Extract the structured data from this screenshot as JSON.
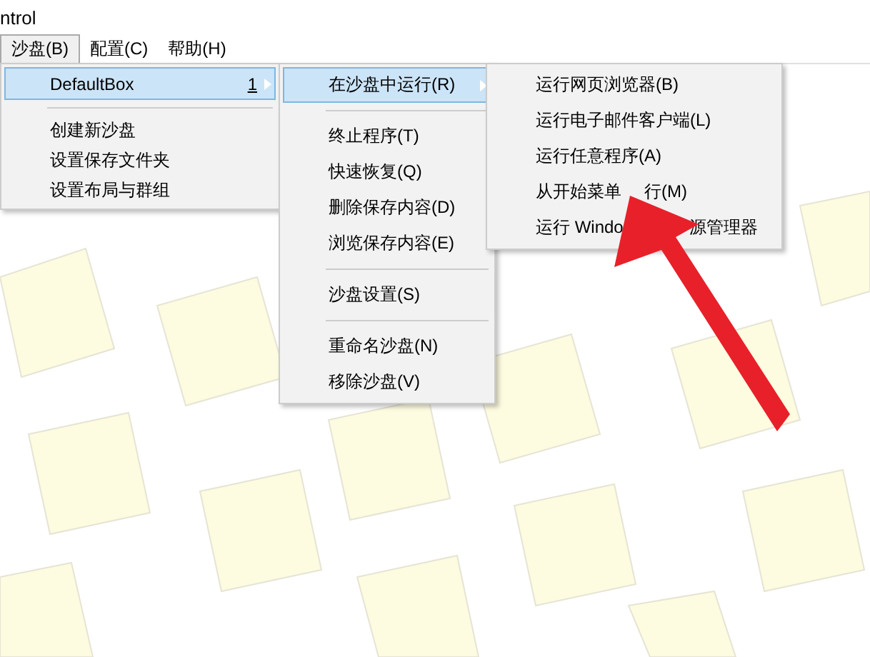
{
  "window": {
    "title": "ntrol"
  },
  "menubar": [
    {
      "label": "沙盘(B)",
      "selected": true
    },
    {
      "label": "配置(C)",
      "selected": false
    },
    {
      "label": "帮助(H)",
      "selected": false
    }
  ],
  "menus": [
    {
      "items": [
        {
          "kind": "item",
          "label": "DefaultBox",
          "shortcut": "1",
          "selected": true,
          "submenu": true
        },
        {
          "kind": "separator"
        },
        {
          "kind": "item",
          "label": "创建新沙盘",
          "selected": false,
          "submenu": false
        },
        {
          "kind": "item",
          "label": "设置保存文件夹",
          "selected": false,
          "submenu": false
        },
        {
          "kind": "item",
          "label": "设置布局与群组",
          "selected": false,
          "submenu": false
        }
      ]
    },
    {
      "items": [
        {
          "kind": "item",
          "label": "在沙盘中运行(R)",
          "selected": true,
          "submenu": true
        },
        {
          "kind": "separator"
        },
        {
          "kind": "item",
          "label": "终止程序(T)",
          "selected": false,
          "submenu": false
        },
        {
          "kind": "item",
          "label": "快速恢复(Q)",
          "selected": false,
          "submenu": false
        },
        {
          "kind": "item",
          "label": "删除保存内容(D)",
          "selected": false,
          "submenu": false
        },
        {
          "kind": "item",
          "label": "浏览保存内容(E)",
          "selected": false,
          "submenu": false
        },
        {
          "kind": "separator"
        },
        {
          "kind": "item",
          "label": "沙盘设置(S)",
          "selected": false,
          "submenu": false
        },
        {
          "kind": "separator"
        },
        {
          "kind": "item",
          "label": "重命名沙盘(N)",
          "selected": false,
          "submenu": false
        },
        {
          "kind": "item",
          "label": "移除沙盘(V)",
          "selected": false,
          "submenu": false
        }
      ]
    },
    {
      "items": [
        {
          "kind": "item",
          "label": "运行网页浏览器(B)",
          "selected": false,
          "submenu": false
        },
        {
          "kind": "item",
          "label": "运行电子邮件客户端(L)",
          "selected": false,
          "submenu": false
        },
        {
          "kind": "item",
          "label": "运行任意程序(A)",
          "selected": false,
          "submenu": false
        },
        {
          "kind": "covered",
          "parts": [
            "从开始菜单",
            "行(M)"
          ],
          "selected": false,
          "submenu": false
        },
        {
          "kind": "covered",
          "parts": [
            "运行 Windo",
            "源管理器"
          ],
          "selected": false,
          "submenu": false
        }
      ]
    }
  ]
}
